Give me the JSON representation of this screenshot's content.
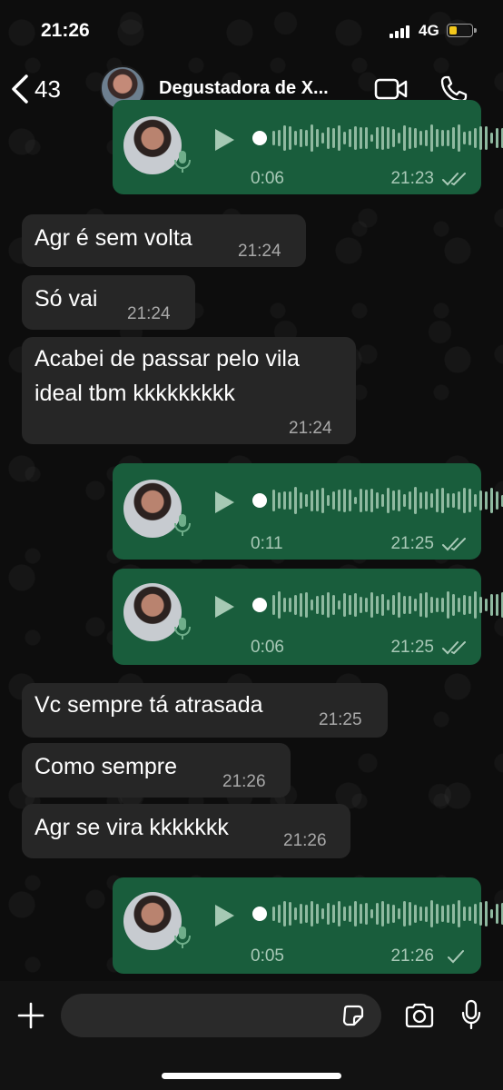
{
  "status_bar": {
    "time": "21:26",
    "network": "4G",
    "battery_level": 0.35,
    "battery_color": "#f3c81b"
  },
  "header": {
    "back_count": "43",
    "contact_name": "Degustadora de X..."
  },
  "messages": [
    {
      "type": "voice",
      "direction": "out",
      "duration": "0:06",
      "time": "21:23",
      "status": "read"
    },
    {
      "type": "text",
      "direction": "in",
      "text": "Agr é sem volta",
      "time": "21:24"
    },
    {
      "type": "text",
      "direction": "in",
      "text": "Só vai",
      "time": "21:24"
    },
    {
      "type": "text",
      "direction": "in",
      "text_line1": "Acabei de passar pelo vila",
      "text_line2": "ideal tbm kkkkkkkkk",
      "time": "21:24"
    },
    {
      "type": "voice",
      "direction": "out",
      "duration": "0:11",
      "time": "21:25",
      "status": "read"
    },
    {
      "type": "voice",
      "direction": "out",
      "duration": "0:06",
      "time": "21:25",
      "status": "read"
    },
    {
      "type": "text",
      "direction": "in",
      "text": "Vc sempre tá atrasada",
      "time": "21:25"
    },
    {
      "type": "text",
      "direction": "in",
      "text": "Como sempre",
      "time": "21:26"
    },
    {
      "type": "text",
      "direction": "in",
      "text": "Agr se vira kkkkkkk",
      "time": "21:26"
    },
    {
      "type": "voice",
      "direction": "out",
      "duration": "0:05",
      "time": "21:26",
      "status": "delivered"
    }
  ],
  "input": {
    "placeholder": ""
  },
  "colors": {
    "incoming_bubble": "#262626",
    "outgoing_bubble": "#195d3c",
    "background": "#0d0d0d"
  },
  "icons": [
    "back-chevron-icon",
    "video-call-icon",
    "phone-icon",
    "play-icon",
    "mic-icon",
    "read-ticks-icon",
    "delivered-tick-icon",
    "plus-icon",
    "sticker-icon",
    "camera-icon"
  ]
}
